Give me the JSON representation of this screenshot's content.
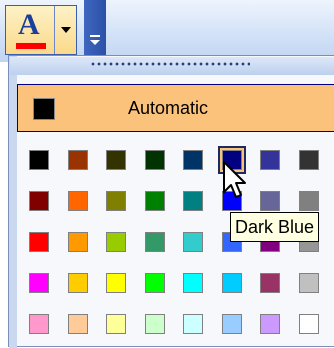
{
  "toolbar": {
    "font_color_button": {
      "letter": "A",
      "current_color": "#ff0000"
    }
  },
  "panel": {
    "automatic_label": "Automatic",
    "automatic_color": "#000000",
    "tooltip": "Dark Blue",
    "selected": {
      "row": 0,
      "col": 5
    },
    "colors": [
      [
        "#000000",
        "#993300",
        "#333300",
        "#003300",
        "#003366",
        "#000080",
        "#333399",
        "#333333"
      ],
      [
        "#800000",
        "#ff6600",
        "#808000",
        "#008000",
        "#008080",
        "#0000ff",
        "#666699",
        "#808080"
      ],
      [
        "#ff0000",
        "#ff9900",
        "#99cc00",
        "#339966",
        "#33cccc",
        "#3366ff",
        "#800080",
        "#969696"
      ],
      [
        "#ff00ff",
        "#ffcc00",
        "#ffff00",
        "#00ff00",
        "#00ffff",
        "#00ccff",
        "#993366",
        "#c0c0c0"
      ],
      [
        "#ff99cc",
        "#ffcc99",
        "#ffff99",
        "#ccffcc",
        "#ccffff",
        "#99ccff",
        "#cc99ff",
        "#ffffff"
      ]
    ]
  }
}
